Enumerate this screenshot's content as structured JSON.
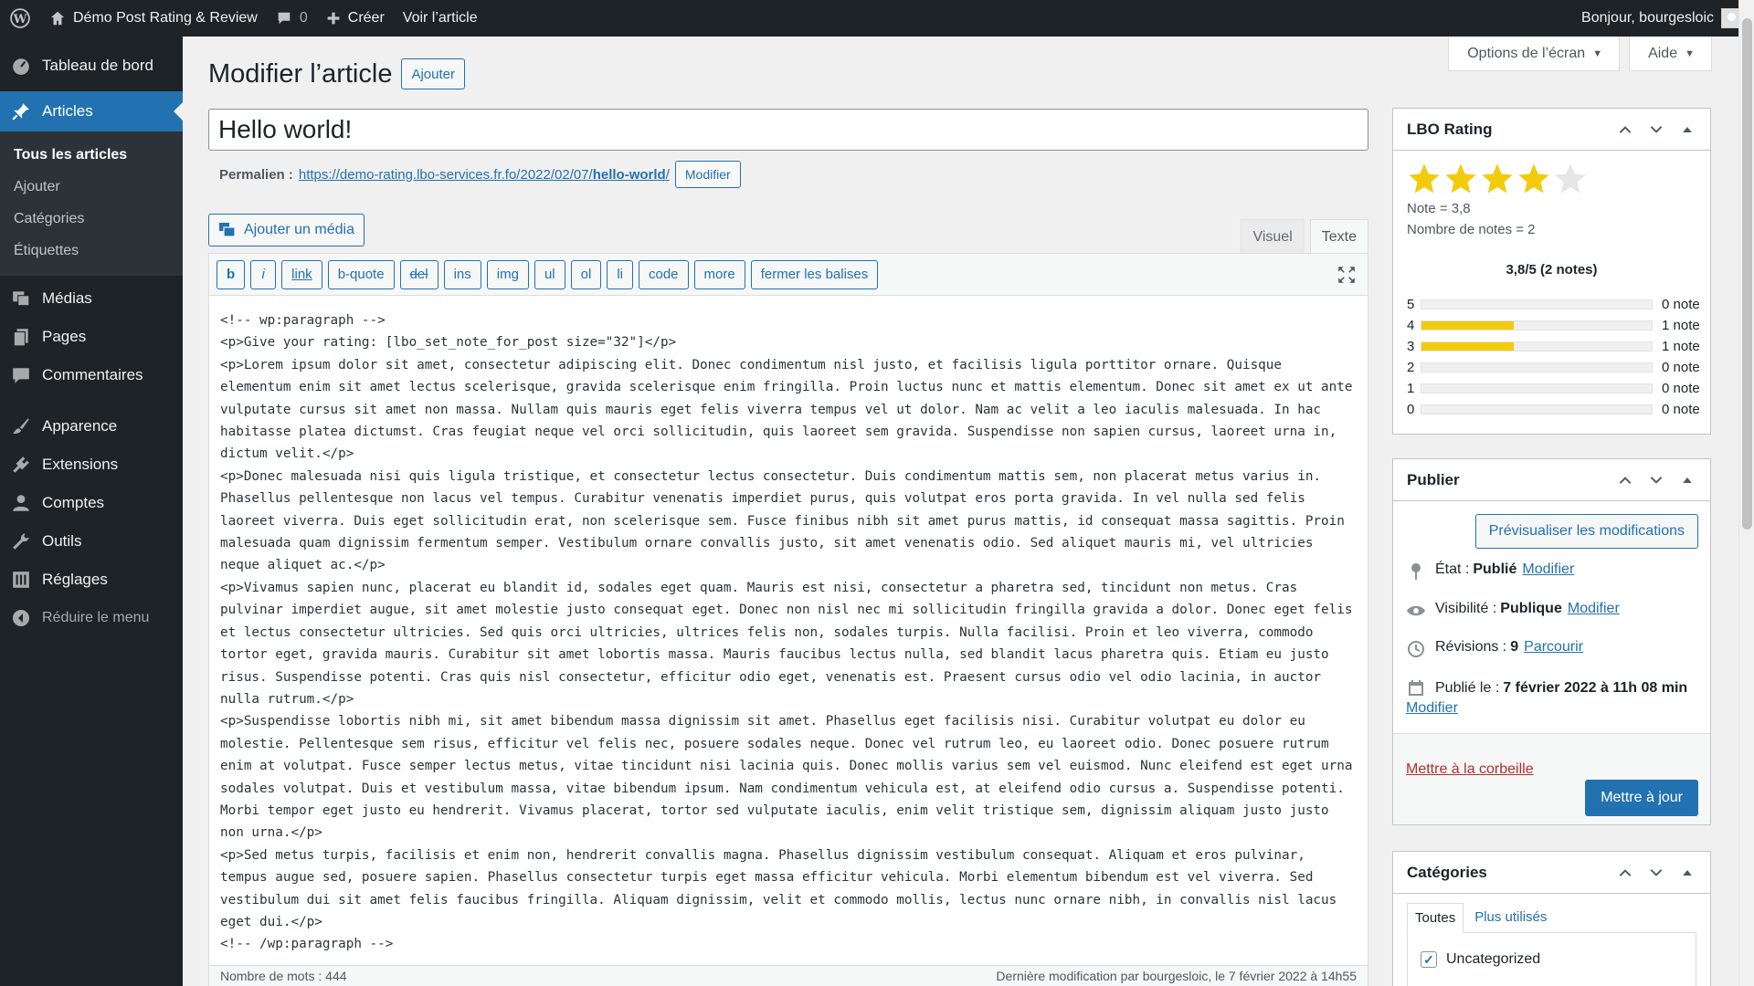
{
  "admin_bar": {
    "site_name": "Démo Post Rating & Review",
    "comments_count": "0",
    "new_label": "Créer",
    "view_label": "Voir l’article",
    "greeting": "Bonjour, bourgesloic"
  },
  "sidebar": {
    "items": [
      {
        "label": "Tableau de bord",
        "icon": "dashboard-icon"
      },
      {
        "label": "Articles",
        "icon": "pin-icon"
      },
      {
        "label": "Médias",
        "icon": "media-icon"
      },
      {
        "label": "Pages",
        "icon": "pages-icon"
      },
      {
        "label": "Commentaires",
        "icon": "comment-icon"
      },
      {
        "label": "Apparence",
        "icon": "brush-icon"
      },
      {
        "label": "Extensions",
        "icon": "plugin-icon"
      },
      {
        "label": "Comptes",
        "icon": "user-icon"
      },
      {
        "label": "Outils",
        "icon": "wrench-icon"
      },
      {
        "label": "Réglages",
        "icon": "settings-icon"
      },
      {
        "label": "Réduire le menu",
        "icon": "collapse-icon"
      }
    ],
    "submenu": [
      "Tous les articles",
      "Ajouter",
      "Catégories",
      "Étiquettes"
    ]
  },
  "screen_options": {
    "options_label": "Options de l’écran",
    "help_label": "Aide"
  },
  "page": {
    "title": "Modifier l’article",
    "add_button": "Ajouter",
    "post_title": "Hello world!",
    "permalink_label": "Permalien :",
    "permalink_base": "https://demo-rating.lbo-services.fr.fo/2022/02/07/",
    "permalink_slug": "hello-world",
    "permalink_end": "/",
    "permalink_edit": "Modifier",
    "add_media": "Ajouter un média",
    "tab_visual": "Visuel",
    "tab_text": "Texte"
  },
  "toolbar": {
    "buttons": [
      "b",
      "i",
      "link",
      "b-quote",
      "del",
      "ins",
      "img",
      "ul",
      "ol",
      "li",
      "code",
      "more",
      "fermer les balises"
    ]
  },
  "editor": {
    "content": "<!-- wp:paragraph -->\n<p>Give your rating: [lbo_set_note_for_post size=\"32\"]</p>\n<p>Lorem ipsum dolor sit amet, consectetur adipiscing elit. Donec condimentum nisl justo, et facilisis ligula porttitor ornare. Quisque elementum enim sit amet lectus scelerisque, gravida scelerisque enim fringilla. Proin luctus nunc et mattis elementum. Donec sit amet ex ut ante vulputate cursus sit amet non massa. Nullam quis mauris eget felis viverra tempus vel ut dolor. Nam ac velit a leo iaculis malesuada. In hac habitasse platea dictumst. Cras feugiat neque vel orci sollicitudin, quis laoreet sem gravida. Suspendisse non sapien cursus, laoreet urna in, dictum velit.</p>\n<p>Donec malesuada nisi quis ligula tristique, et consectetur lectus consectetur. Duis condimentum mattis sem, non placerat metus varius in. Phasellus pellentesque non lacus vel tempus. Curabitur venenatis imperdiet purus, quis volutpat eros porta gravida. In vel nulla sed felis laoreet viverra. Duis eget sollicitudin erat, non scelerisque sem. Fusce finibus nibh sit amet purus mattis, id consequat massa sagittis. Proin malesuada quam dignissim fermentum semper. Vestibulum ornare convallis justo, sit amet venenatis odio. Sed aliquet mauris mi, vel ultricies neque aliquet ac.</p>\n<p>Vivamus sapien nunc, placerat eu blandit id, sodales eget quam. Mauris est nisi, consectetur a pharetra sed, tincidunt non metus. Cras pulvinar imperdiet augue, sit amet molestie justo consequat eget. Donec non nisl nec mi sollicitudin fringilla gravida a dolor. Donec eget felis et lectus consectetur ultricies. Sed quis orci ultricies, ultrices felis non, sodales turpis. Nulla facilisi. Proin et leo viverra, commodo tortor eget, gravida mauris. Curabitur sit amet lobortis massa. Mauris faucibus lectus nulla, sed blandit lacus pharetra quis. Etiam eu justo risus. Suspendisse potenti. Cras quis nisl consectetur, efficitur odio eget, venenatis est. Praesent cursus odio vel odio lacinia, in auctor nulla rutrum.</p>\n<p>Suspendisse lobortis nibh mi, sit amet bibendum massa dignissim sit amet. Phasellus eget facilisis nisi. Curabitur volutpat eu dolor eu molestie. Pellentesque sem risus, efficitur vel felis nec, posuere sodales neque. Donec vel rutrum leo, eu laoreet odio. Donec posuere rutrum enim at volutpat. Fusce semper lectus metus, vitae tincidunt nisi lacinia quis. Donec mollis varius sem vel euismod. Nunc eleifend est eget urna sodales volutpat. Duis et vestibulum massa, vitae bibendum ipsum. Nam condimentum vehicula est, at eleifend odio cursus a. Suspendisse potenti. Morbi tempor eget justo eu hendrerit. Vivamus placerat, tortor sed vulputate iaculis, enim velit tristique sem, dignissim aliquam justo justo non urna.</p>\n<p>Sed metus turpis, facilisis et enim non, hendrerit convallis magna. Phasellus dignissim vestibulum consequat. Aliquam et eros pulvinar, tempus augue sed, posuere sapien. Phasellus consectetur turpis eget massa efficitur vehicula. Morbi elementum bibendum est vel viverra. Sed vestibulum dui sit amet felis faucibus fringilla. Aliquam dignissim, velit et commodo mollis, lectus nunc ornare nibh, in convallis nisl lacus eget dui.</p>\n<!-- /wp:paragraph -->",
    "word_count": "Nombre de mots : 444",
    "last_modified": "Dernière modification par bourgesloic, le 7 février 2022 à 14h55"
  },
  "lbo_rating": {
    "title": "LBO Rating",
    "stars_filled": 4,
    "stars_total": 5,
    "note_line": "Note = 3,8",
    "count_line": "Nombre de notes = 2",
    "summary": "3,8/5 (2 notes)",
    "accent": "#f2cc0c",
    "distribution": [
      {
        "label": "5",
        "fraction": 0,
        "count": "0 note"
      },
      {
        "label": "4",
        "fraction": 0.4,
        "count": "1 note"
      },
      {
        "label": "3",
        "fraction": 0.4,
        "count": "1 note"
      },
      {
        "label": "2",
        "fraction": 0,
        "count": "0 note"
      },
      {
        "label": "1",
        "fraction": 0,
        "count": "0 note"
      },
      {
        "label": "0",
        "fraction": 0,
        "count": "0 note"
      }
    ]
  },
  "publish": {
    "title": "Publier",
    "preview_button": "Prévisualiser les modifications",
    "status_label": "État :",
    "status_value": "Publié",
    "status_link": "Modifier",
    "visibility_label": "Visibilité :",
    "visibility_value": "Publique",
    "visibility_link": "Modifier",
    "revisions_label": "Révisions :",
    "revisions_value": "9",
    "revisions_link": "Parcourir",
    "published_label": "Publié le :",
    "published_value": "7 février 2022 à 11h 08 min",
    "published_link": "Modifier",
    "trash_link": "Mettre à la corbeille",
    "update_button": "Mettre à jour"
  },
  "categories": {
    "title": "Catégories",
    "tab_all": "Toutes",
    "tab_popular": "Plus utilisés",
    "items": [
      {
        "label": "Uncategorized",
        "checked": true
      }
    ]
  },
  "colors": {
    "admin_dark": "#1d2327",
    "primary": "#2271b1"
  }
}
